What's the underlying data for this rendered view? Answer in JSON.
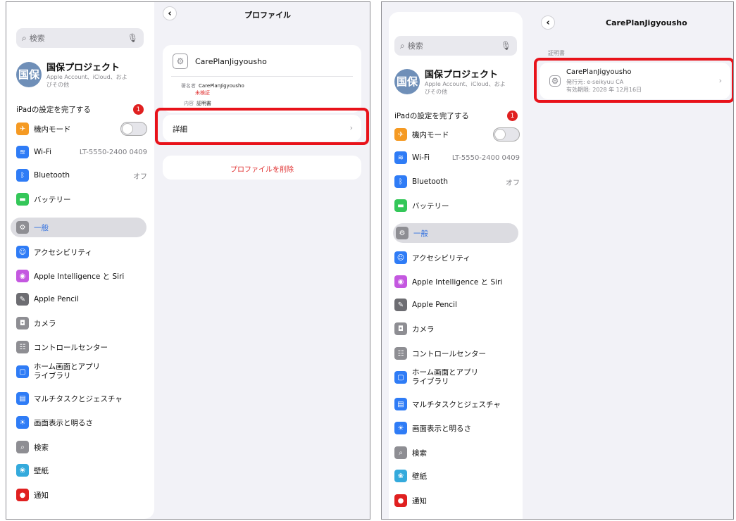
{
  "left": {
    "nav_title": "プロファイル",
    "search_placeholder": "検索",
    "account": {
      "avatar": "国保",
      "name": "国保プロジェクト",
      "subtitle": "Apple Account、iCloud、およびその他"
    },
    "setup": {
      "label": "iPadの設定を完了する",
      "badge": "1"
    },
    "profile": {
      "name": "CarePlanJigyousho",
      "signer_label": "署名者",
      "signer_value": "CarePlanJigyousho",
      "unverified": "未検証",
      "content_label": "内容",
      "content_value": "証明書"
    },
    "details_label": "詳細",
    "delete_label": "プロファイルを削除"
  },
  "right": {
    "nav_title": "CarePlanJigyousho",
    "search_placeholder": "検索",
    "account": {
      "avatar": "国保",
      "name": "国保プロジェクト",
      "subtitle": "Apple Account、iCloud、およびその他"
    },
    "setup": {
      "label": "iPadの設定を完了する",
      "badge": "1"
    },
    "section_header": "証明書",
    "certificate": {
      "name": "CarePlanJigyousho",
      "issuer": "発行元: e-seikyuu CA",
      "expiry": "有効期限: 2028 年 12月16日"
    }
  },
  "menu": [
    {
      "label": "機内モード",
      "icon": "airplane-icon",
      "color": "#f59a23",
      "glyph": "✈",
      "value": "",
      "toggle": true
    },
    {
      "label": "Wi-Fi",
      "icon": "wifi-icon",
      "color": "#2f7cf6",
      "glyph": "≋",
      "value": "LT-5550-2400 0409"
    },
    {
      "label": "Bluetooth",
      "icon": "bluetooth-icon",
      "color": "#2f7cf6",
      "glyph": "ᛒ",
      "value": "オフ"
    },
    {
      "label": "バッテリー",
      "icon": "battery-icon",
      "color": "#34c759",
      "glyph": "▬",
      "value": ""
    },
    {
      "label": "一般",
      "icon": "gear-icon",
      "color": "#8e8e93",
      "glyph": "⚙",
      "value": "",
      "selected": true
    },
    {
      "label": "アクセシビリティ",
      "icon": "accessibility-icon",
      "color": "#2f7cf6",
      "glyph": "☺",
      "value": ""
    },
    {
      "label": "Apple Intelligence と Siri",
      "icon": "siri-icon",
      "color": "#c458e0",
      "glyph": "◉",
      "value": ""
    },
    {
      "label": "Apple Pencil",
      "icon": "pencil-icon",
      "color": "#6d6d72",
      "glyph": "✎",
      "value": ""
    },
    {
      "label": "カメラ",
      "icon": "camera-icon",
      "color": "#8e8e93",
      "glyph": "◘",
      "value": ""
    },
    {
      "label": "コントロールセンター",
      "icon": "control-center-icon",
      "color": "#8e8e93",
      "glyph": "☷",
      "value": ""
    },
    {
      "label": "ホーム画面とアプリ",
      "label2": "ライブラリ",
      "icon": "home-screen-icon",
      "color": "#2f7cf6",
      "glyph": "▢",
      "value": ""
    },
    {
      "label": "マルチタスクとジェスチャ",
      "icon": "multitask-icon",
      "color": "#2f7cf6",
      "glyph": "▤",
      "value": ""
    },
    {
      "label": "画面表示と明るさ",
      "icon": "brightness-icon",
      "color": "#2f7cf6",
      "glyph": "☀",
      "value": ""
    },
    {
      "label": "検索",
      "icon": "search-settings-icon",
      "color": "#8e8e93",
      "glyph": "⌕",
      "value": ""
    },
    {
      "label": "壁紙",
      "icon": "wallpaper-icon",
      "color": "#34aadc",
      "glyph": "❀",
      "value": ""
    },
    {
      "label": "通知",
      "icon": "notifications-icon",
      "color": "#e02020",
      "glyph": "●",
      "value": ""
    }
  ]
}
